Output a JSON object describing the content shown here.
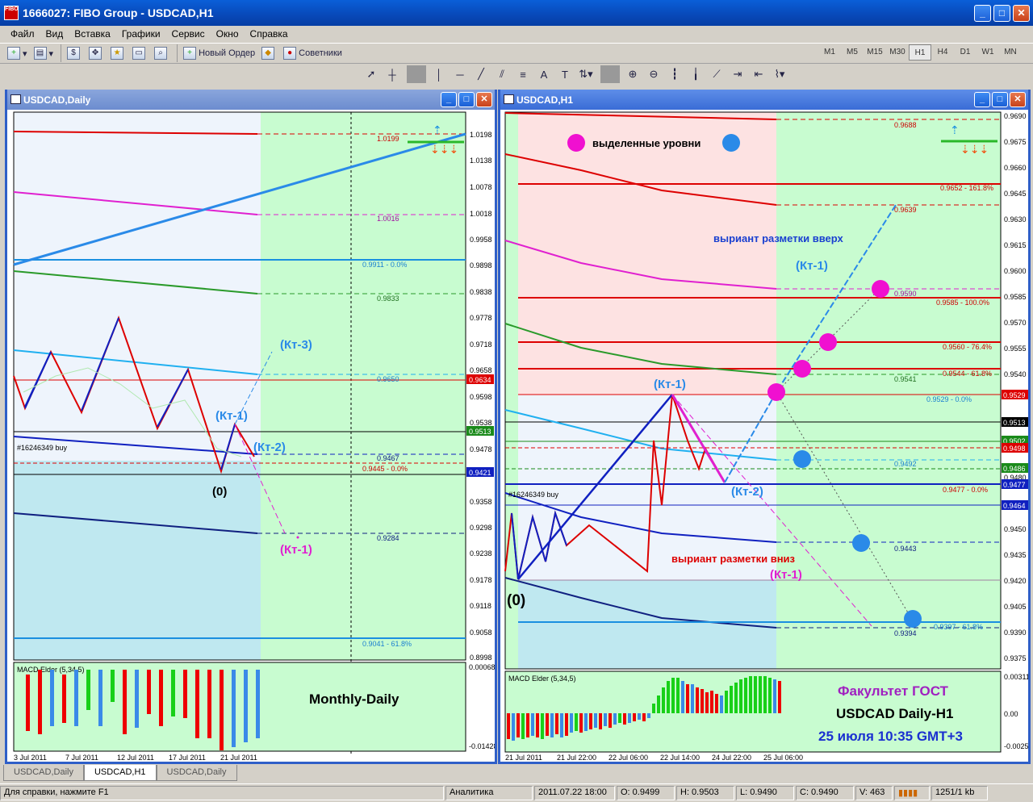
{
  "window": {
    "title": "1666027: FIBO Group - USDCAD,H1",
    "icon_text": "FIBO"
  },
  "menu": [
    "Файл",
    "Вид",
    "Вставка",
    "Графики",
    "Сервис",
    "Окно",
    "Справка"
  ],
  "toolbar": {
    "new_order": "Новый Ордер",
    "advisors": "Советники"
  },
  "timeframes": [
    "M1",
    "M5",
    "M15",
    "M30",
    "H1",
    "H4",
    "D1",
    "W1",
    "MN"
  ],
  "active_timeframe": "H1",
  "tabs": [
    "USDCAD,Daily",
    "USDCAD,H1",
    "USDCAD,Daily"
  ],
  "active_tab": 1,
  "status": {
    "help": "Для справки, нажмите F1",
    "profile": "Аналитика",
    "datetime": "2011.07.22 18:00",
    "open": "O: 0.9499",
    "high": "H: 0.9503",
    "low": "L: 0.9490",
    "close": "C: 0.9490",
    "volume": "V: 463",
    "traffic": "1251/1 kb"
  },
  "left": {
    "title": "USDCAD,Daily",
    "ticks": [
      "1.0198",
      "1.0138",
      "1.0078",
      "1.0018",
      "0.9958",
      "0.9898",
      "0.9838",
      "0.9778",
      "0.9718",
      "0.9658",
      "0.9598",
      "0.9538",
      "0.9478",
      "0.9358",
      "0.9298",
      "0.9238",
      "0.9178",
      "0.9118",
      "0.9058",
      "0.8998"
    ],
    "tag_red": "0.9634",
    "tag_green": "0.9513",
    "tag_blue": "0.9421",
    "levels": {
      "a": "1.0199",
      "b": "1.0016",
      "c": "0.9911 - 0.0%",
      "d": "0.9833",
      "e": "0.9650",
      "f": "0.9467",
      "g": "0.9445 - 0.0%",
      "h": "0.9284",
      "i": "0.9041 - 61.8%"
    },
    "order": "#16246349 buy",
    "labels": {
      "kt3": "(Кт-3)",
      "kt1": "(Кт-1)",
      "kt2": "(Кт-2)",
      "zero": "(0)",
      "kt1m": "(Кт-1)"
    },
    "macd_title": "MACD Elder (5,34,5)",
    "macd_ticks": [
      "0.00068",
      "-0.01428"
    ],
    "caption": "Monthly-Daily",
    "dates": [
      "3 Jul 2011",
      "7 Jul 2011",
      "12 Jul 2011",
      "17 Jul 2011",
      "21 Jul 2011"
    ]
  },
  "right": {
    "title": "USDCAD,H1",
    "ticks": [
      "0.9690",
      "0.9675",
      "0.9660",
      "0.9645",
      "0.9630",
      "0.9615",
      "0.9600",
      "0.9585",
      "0.9570",
      "0.9555",
      "0.9540",
      "0.9480",
      "0.9450",
      "0.9435",
      "0.9420",
      "0.9405",
      "0.9390",
      "0.9375"
    ],
    "tags": {
      "a": "0.9529",
      "b": "0.9513",
      "c": "0.9502",
      "d": "0.9498",
      "e": "0.9486",
      "f": "0.9477",
      "g": "0.9464"
    },
    "levels": {
      "a": "0.9688",
      "b": "0.9652 - 161.8%",
      "c": "0.9639",
      "d": "0.9590",
      "e": "0.9585 - 100.0%",
      "f": "0.9560 - 76.4%",
      "g": "0.9544 - 61.8%",
      "h": "0.9541",
      "i": "0.9529 - 0.0%",
      "j": "0.9492",
      "k": "0.9477 - 0.0%",
      "l": "0.9443",
      "m": "0.9397 - 61.8%",
      "n": "0.9394"
    },
    "order": "#16246349 buy",
    "legend": "выделенные уровни",
    "up_variant": "выриант разметки вверх",
    "down_variant": "выриант разметки вниз",
    "labels": {
      "kt1up": "(Кт-1)",
      "kt1top": "(Кт-1)",
      "kt2": "(Кт-2)",
      "kt1down": "(Кт-1)",
      "zero": "(0)"
    },
    "macd_title": "MACD Elder (5,34,5)",
    "macd_ticks": [
      "0.00311",
      "0.00",
      "-0.0025"
    ],
    "cap1": "Факультет ГОСТ",
    "cap2": "USDCAD Daily-H1",
    "cap3": "25 июля 10:35 GMT+3",
    "dates": [
      "21 Jul 2011",
      "21 Jul 22:00",
      "22 Jul 06:00",
      "22 Jul 14:00",
      "24 Jul 22:00",
      "25 Jul 06:00"
    ]
  }
}
